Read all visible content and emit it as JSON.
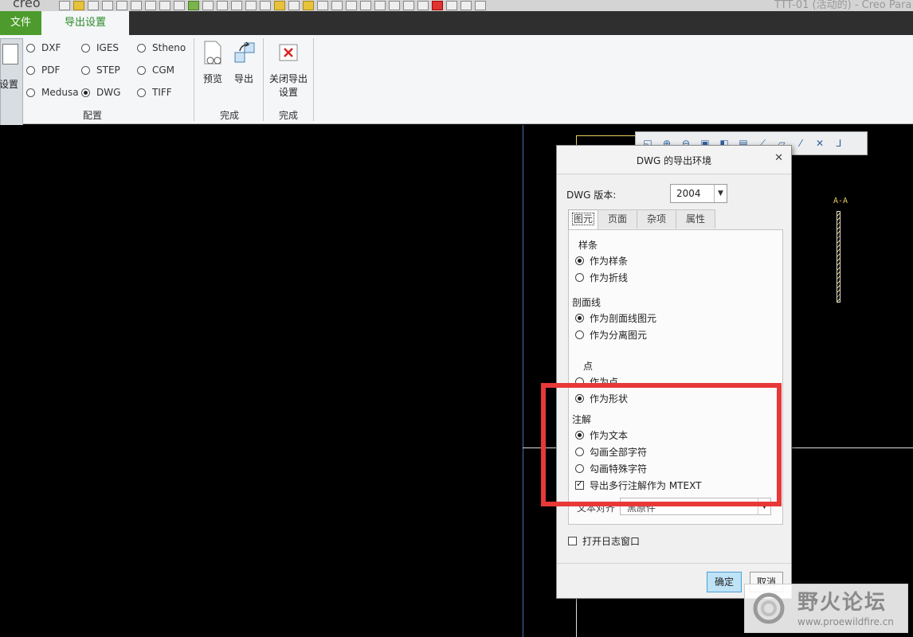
{
  "titlebar": {
    "logo": "creo",
    "window_title": "TTT-01 (活动的) - Creo Para"
  },
  "ribbon_tabs": {
    "file": "文件",
    "export_setup": "导出设置"
  },
  "ribbon": {
    "setup_label": "设置",
    "formats": [
      {
        "label": "DXF",
        "selected": false
      },
      {
        "label": "PDF",
        "selected": false
      },
      {
        "label": "Medusa",
        "selected": false
      },
      {
        "label": "IGES",
        "selected": false
      },
      {
        "label": "STEP",
        "selected": false
      },
      {
        "label": "DWG",
        "selected": true
      },
      {
        "label": "Stheno",
        "selected": false
      },
      {
        "label": "CGM",
        "selected": false
      },
      {
        "label": "TIFF",
        "selected": false
      }
    ],
    "config_group": "配置",
    "preview": "预览",
    "export": "导出",
    "finish_group_1": "完成",
    "close_export_line1": "关闭导出",
    "close_export_line2": "设置",
    "finish_group_2": "完成"
  },
  "drawing": {
    "section_label": "A-A"
  },
  "dialog": {
    "title": "DWG 的导出环境",
    "close_icon": "close-icon",
    "version_label": "DWG 版本:",
    "version_value": "2004",
    "tabs": [
      "图元",
      "页面",
      "杂项",
      "属性"
    ],
    "active_tab": "图元",
    "spline": {
      "label": "样条",
      "opt1": "作为样条",
      "opt2": "作为折线",
      "selected": 1
    },
    "hatch": {
      "label": "剖面线",
      "opt1": "作为剖面线图元",
      "opt2": "作为分离图元",
      "selected": 1
    },
    "point": {
      "label": "点",
      "opt1": "作为点",
      "opt2": "作为形状",
      "selected": 2
    },
    "annotation": {
      "label": "注解",
      "opt1": "作为文本",
      "opt2": "勾画全部字符",
      "opt3": "勾画特殊字符",
      "selected": 1,
      "mtext_label": "导出多行注解作为 MTEXT",
      "mtext_checked": true
    },
    "text_align": {
      "label": "文本对齐",
      "value": "黑原件"
    },
    "log_window": {
      "label": "打开日志窗口",
      "checked": false
    },
    "ok": "确定",
    "cancel": "取消"
  },
  "watermark": {
    "name": "野火论坛",
    "url": "www.proewildfire.cn"
  },
  "colors": {
    "accent_green": "#4d9b2c",
    "highlight_red": "#e83838",
    "ok_button": "#bfe3f6"
  }
}
